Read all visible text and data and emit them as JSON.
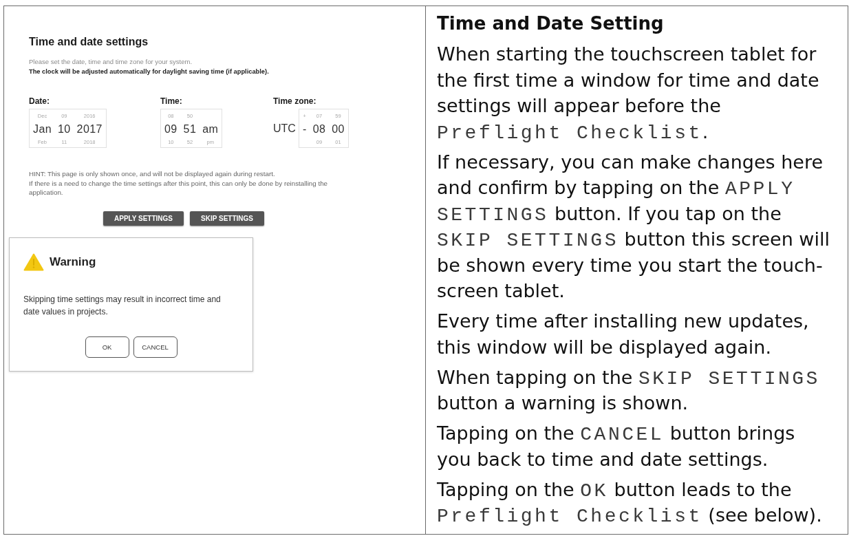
{
  "settings_screen": {
    "title": "Time and date settings",
    "intro": "Please set the date, time and time zone for your system.",
    "note": "The clock will be adjusted automatically for daylight saving time (if applicable).",
    "pickers": [
      {
        "label": "Date:",
        "columns": [
          {
            "above": "Dec",
            "value": "Jan",
            "below": "Feb"
          },
          {
            "above": "09",
            "value": "10",
            "below": "11"
          },
          {
            "above": "2016",
            "value": "2017",
            "below": "2018"
          }
        ]
      },
      {
        "label": "Time:",
        "columns": [
          {
            "above": "08",
            "value": "09",
            "below": "10"
          },
          {
            "above": "50",
            "value": "51",
            "below": "52"
          },
          {
            "value": "am",
            "below": "pm"
          }
        ]
      },
      {
        "label": "Time zone:",
        "prefix": "UTC",
        "columns": [
          {
            "above": "+",
            "value": "-"
          },
          {
            "above": "07",
            "value": "08",
            "below": "09"
          },
          {
            "above": "59",
            "value": "00",
            "below": "01"
          }
        ]
      }
    ],
    "hint": "HINT: This page is only shown once, and will not be displayed again during restart.",
    "hint_2": "If there is a need to change the time settings after this point, this can only be done by reinstalling the application.",
    "buttons": [
      "APPLY SETTINGS",
      "SKIP SETTINGS"
    ]
  },
  "warning_dialog": {
    "title": "Warning",
    "message": "Skipping time settings may result in incorrect time and date values in projects.",
    "buttons": [
      "OK",
      "CANCEL"
    ]
  },
  "instructions": {
    "title": "Time and Date Setting",
    "paragraphs": [
      {
        "segments": [
          {
            "kind": "text",
            "text": "When starting the touchscreen tablet for the first time a window for time and date settings will appear before the "
          },
          {
            "kind": "code",
            "text": "Preflight Checklist"
          },
          {
            "kind": "text",
            "text": "."
          }
        ]
      },
      {
        "segments": [
          {
            "kind": "text",
            "text": "If necessary, you can make changes here and confirm by tapping on the "
          },
          {
            "kind": "code",
            "text": "APPLY SETTINGS"
          },
          {
            "kind": "text",
            "text": " button. If you tap on the "
          },
          {
            "kind": "code",
            "text": "SKIP SETTINGS"
          },
          {
            "kind": "text",
            "text": " button this screen will be shown every time you start the touch-screen tablet."
          }
        ]
      },
      {
        "segments": [
          {
            "kind": "text",
            "text": "Every time after installing new updates, this window will be displayed again."
          }
        ]
      },
      {
        "segments": [
          {
            "kind": "text",
            "text": "When tapping on the "
          },
          {
            "kind": "code",
            "text": "SKIP SETTINGS"
          },
          {
            "kind": "text",
            "text": " button a warning is shown."
          }
        ]
      },
      {
        "segments": [
          {
            "kind": "text",
            "text": "Tapping on the "
          },
          {
            "kind": "code",
            "text": "CANCEL"
          },
          {
            "kind": "text",
            "text": " button brings you back to time and date settings."
          }
        ]
      },
      {
        "segments": [
          {
            "kind": "text",
            "text": "Tapping on the "
          },
          {
            "kind": "code",
            "text": "OK"
          },
          {
            "kind": "text",
            "text": " button leads to the "
          },
          {
            "kind": "code",
            "text": "Preflight Checklist"
          },
          {
            "kind": "text",
            "text": " (see below)."
          }
        ]
      }
    ]
  }
}
